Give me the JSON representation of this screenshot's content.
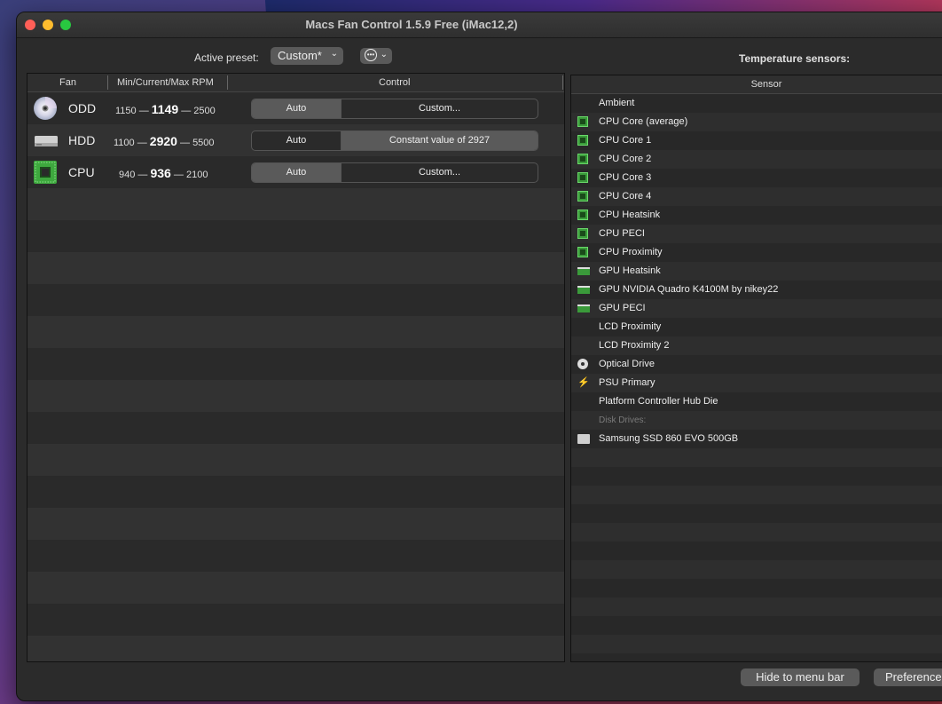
{
  "window": {
    "title": "Macs Fan Control 1.5.9 Free (iMac12,2)"
  },
  "preset": {
    "label": "Active preset:",
    "value": "Custom*"
  },
  "temp_sensors_title": "Temperature sensors:",
  "fan_table": {
    "headers": {
      "fan": "Fan",
      "rpm": "Min/Current/Max RPM",
      "control": "Control"
    },
    "fans": [
      {
        "name": "ODD",
        "icon": "optical-disc-icon",
        "min": "1150",
        "current": "1149",
        "max": "2500",
        "auto_label": "Auto",
        "custom_label": "Custom...",
        "selected": "auto"
      },
      {
        "name": "HDD",
        "icon": "hard-drive-icon",
        "min": "1100",
        "current": "2920",
        "max": "5500",
        "auto_label": "Auto",
        "custom_label": "Constant value of 2927",
        "selected": "custom"
      },
      {
        "name": "CPU",
        "icon": "cpu-chip-icon",
        "min": "940",
        "current": "936",
        "max": "2100",
        "auto_label": "Auto",
        "custom_label": "Custom...",
        "selected": "auto"
      }
    ]
  },
  "sensor_table": {
    "header": "Sensor",
    "rows": [
      {
        "label": "Ambient",
        "icon": "none"
      },
      {
        "label": "CPU Core (average)",
        "icon": "chip"
      },
      {
        "label": "CPU Core 1",
        "icon": "chip"
      },
      {
        "label": "CPU Core 2",
        "icon": "chip"
      },
      {
        "label": "CPU Core 3",
        "icon": "chip"
      },
      {
        "label": "CPU Core 4",
        "icon": "chip"
      },
      {
        "label": "CPU Heatsink",
        "icon": "chip"
      },
      {
        "label": "CPU PECI",
        "icon": "chip"
      },
      {
        "label": "CPU Proximity",
        "icon": "chip"
      },
      {
        "label": "GPU Heatsink",
        "icon": "gpu"
      },
      {
        "label": "GPU NVIDIA Quadro K4100M by nikey22",
        "icon": "gpu"
      },
      {
        "label": "GPU PECI",
        "icon": "gpu"
      },
      {
        "label": "LCD Proximity",
        "icon": "none"
      },
      {
        "label": "LCD Proximity 2",
        "icon": "none"
      },
      {
        "label": "Optical Drive",
        "icon": "disc"
      },
      {
        "label": "PSU Primary",
        "icon": "bolt"
      },
      {
        "label": "Platform Controller Hub Die",
        "icon": "none"
      },
      {
        "label": "Disk Drives:",
        "icon": "section"
      },
      {
        "label": "Samsung SSD 860 EVO 500GB",
        "icon": "ssd"
      }
    ]
  },
  "buttons": {
    "hide_menu_bar": "Hide to menu bar",
    "preferences": "Preferences"
  },
  "colors": {
    "window_bg": "#2b2b2b",
    "selected_segment": "#5a5a5a",
    "chip_green": "#3a9a3a",
    "bolt_yellow": "#f5c400"
  }
}
